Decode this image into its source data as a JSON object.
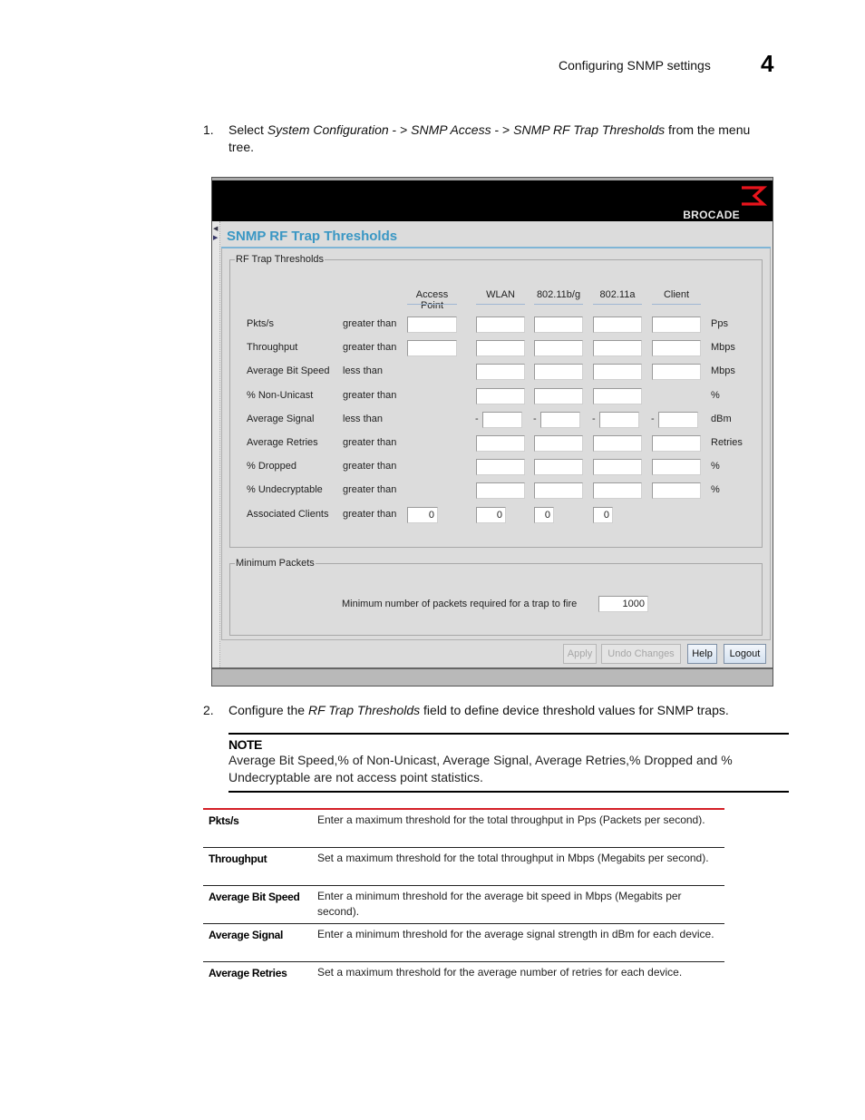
{
  "page_header": {
    "section": "Configuring SNMP settings",
    "chapter": "4"
  },
  "step1": {
    "number": "1.",
    "pre": "Select ",
    "path1": "System Configuration",
    "sep1": " - > ",
    "path2": "SNMP Access",
    "sep2": " - > ",
    "path3": "SNMP RF Trap Thresholds",
    "post": " from the menu",
    "line2": "tree."
  },
  "screenshot": {
    "brand": "BROCADE",
    "brand_color": "#e8141c",
    "panel_title": "SNMP RF Trap Thresholds",
    "title_color": "#3a97c4",
    "rf_group": {
      "legend": "RF Trap Thresholds",
      "columns": [
        "Access Point",
        "WLAN",
        "802.11b/g",
        "802.11a",
        "Client"
      ],
      "rows": [
        {
          "label": "Pkts/s",
          "condition": "greater than",
          "unit": "Pps",
          "fields": [
            "",
            "",
            "",
            "",
            ""
          ],
          "negative": false
        },
        {
          "label": "Throughput",
          "condition": "greater than",
          "unit": "Mbps",
          "fields": [
            "",
            "",
            "",
            "",
            ""
          ],
          "negative": false
        },
        {
          "label": "Average Bit Speed",
          "condition": "less than",
          "unit": "Mbps",
          "fields": [
            null,
            "",
            "",
            "",
            ""
          ],
          "negative": false
        },
        {
          "label": "% Non-Unicast",
          "condition": "greater than",
          "unit": "%",
          "fields": [
            null,
            "",
            "",
            "",
            null
          ],
          "negative": false
        },
        {
          "label": "Average Signal",
          "condition": "less than",
          "unit": "dBm",
          "fields": [
            null,
            "",
            "",
            "",
            ""
          ],
          "negative": true
        },
        {
          "label": "Average Retries",
          "condition": "greater than",
          "unit": "Retries",
          "fields": [
            null,
            "",
            "",
            "",
            ""
          ],
          "negative": false
        },
        {
          "label": "% Dropped",
          "condition": "greater than",
          "unit": "%",
          "fields": [
            null,
            "",
            "",
            "",
            ""
          ],
          "negative": false
        },
        {
          "label": "% Undecryptable",
          "condition": "greater than",
          "unit": "%",
          "fields": [
            null,
            "",
            "",
            "",
            ""
          ],
          "negative": false
        },
        {
          "label": "Associated Clients",
          "condition": "greater than",
          "unit": "",
          "fields": [
            "0",
            "0",
            "0",
            "0",
            null
          ],
          "negative": false
        }
      ]
    },
    "min_group": {
      "legend": "Minimum Packets",
      "label": "Minimum number of packets required for a trap to fire",
      "value": "1000"
    },
    "buttons": {
      "apply": "Apply",
      "undo": "Undo Changes",
      "help": "Help",
      "logout": "Logout"
    }
  },
  "step2": {
    "number": "2.",
    "pre": "Configure the ",
    "em": "RF Trap Thresholds",
    "post": " field to define device threshold values for SNMP traps."
  },
  "note": {
    "title": "NOTE",
    "body": "Average Bit Speed,% of Non-Unicast, Average Signal, Average Retries,% Dropped and % Undecryptable are not access point statistics."
  },
  "definitions": [
    {
      "term": "Pkts/s",
      "desc": "Enter a maximum threshold for the total throughput in Pps (Packets per second)."
    },
    {
      "term": "Throughput",
      "desc": "Set a maximum threshold for the total throughput in Mbps (Megabits per second)."
    },
    {
      "term": "Average Bit Speed",
      "desc": "Enter a minimum threshold for the average bit speed in Mbps (Megabits per second)."
    },
    {
      "term": "Average Signal",
      "desc": "Enter a minimum threshold for the average signal strength in dBm for each device."
    },
    {
      "term": "Average Retries",
      "desc": "Set a maximum threshold for the average number of retries for each device."
    }
  ]
}
